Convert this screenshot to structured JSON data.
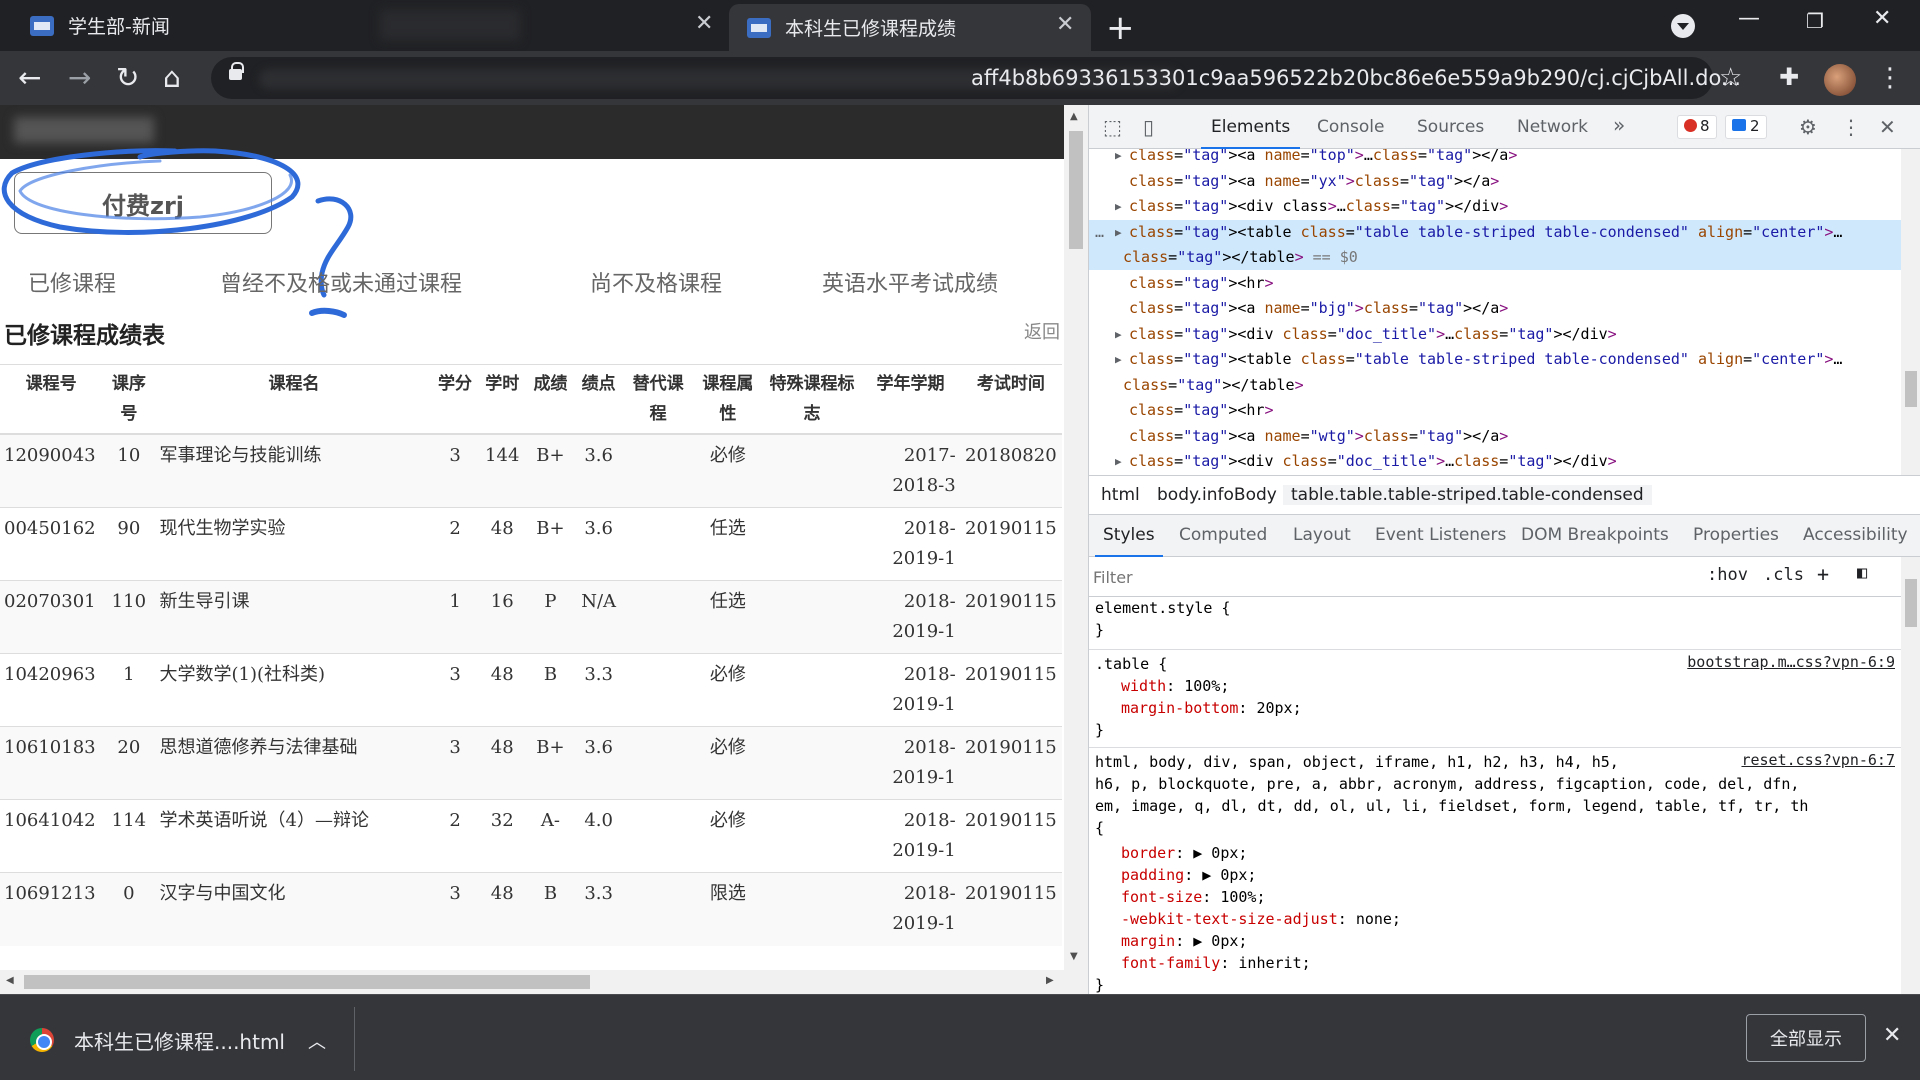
{
  "browser": {
    "tabs": [
      {
        "title": "学生部-新闻",
        "active": false
      },
      {
        "title": "本科生已修课程成绩",
        "active": true
      }
    ],
    "url_visible": "aff4b8b69336153301c9aa596522b20bc86e6e559a9b290/cj.cjCjbAll.do..."
  },
  "page": {
    "pay_button": "付费zrj",
    "scribble_mark": "?",
    "nav_tabs": [
      "已修课程",
      "曾经不及格或未通过课程",
      "尚不及格课程",
      "英语水平考试成绩"
    ],
    "section_title": "已修课程成绩表",
    "back_link": "返回",
    "table": {
      "headers": [
        "课程号",
        "课序号",
        "课程名",
        "学分",
        "学时",
        "成绩",
        "绩点",
        "替代课程",
        "课程属性",
        "特殊课程标志",
        "学年学期",
        "考试时间"
      ],
      "rows": [
        {
          "id": "12090043",
          "seq": "10",
          "name": "军事理论与技能训练",
          "credit": "3",
          "hours": "144",
          "grade": "B+",
          "gpa": "3.6",
          "alt": "",
          "type": "必修",
          "special": "",
          "term": "2017-2018-3",
          "date": "20180820"
        },
        {
          "id": "00450162",
          "seq": "90",
          "name": "现代生物学实验",
          "credit": "2",
          "hours": "48",
          "grade": "B+",
          "gpa": "3.6",
          "alt": "",
          "type": "任选",
          "special": "",
          "term": "2018-2019-1",
          "date": "20190115"
        },
        {
          "id": "02070301",
          "seq": "110",
          "name": "新生导引课",
          "credit": "1",
          "hours": "16",
          "grade": "P",
          "gpa": "N/A",
          "alt": "",
          "type": "任选",
          "special": "",
          "term": "2018-2019-1",
          "date": "20190115"
        },
        {
          "id": "10420963",
          "seq": "1",
          "name": "大学数学(1)(社科类)",
          "credit": "3",
          "hours": "48",
          "grade": "B",
          "gpa": "3.3",
          "alt": "",
          "type": "必修",
          "special": "",
          "term": "2018-2019-1",
          "date": "20190115"
        },
        {
          "id": "10610183",
          "seq": "20",
          "name": "思想道德修养与法律基础",
          "credit": "3",
          "hours": "48",
          "grade": "B+",
          "gpa": "3.6",
          "alt": "",
          "type": "必修",
          "special": "",
          "term": "2018-2019-1",
          "date": "20190115"
        },
        {
          "id": "10641042",
          "seq": "114",
          "name": "学术英语听说（4）—辩论",
          "credit": "2",
          "hours": "32",
          "grade": "A-",
          "gpa": "4.0",
          "alt": "",
          "type": "必修",
          "special": "",
          "term": "2018-2019-1",
          "date": "20190115"
        },
        {
          "id": "10691213",
          "seq": "0",
          "name": "汉字与中国文化",
          "credit": "3",
          "hours": "48",
          "grade": "B",
          "gpa": "3.3",
          "alt": "",
          "type": "限选",
          "special": "",
          "term": "2018-2019-1",
          "date": "20190115"
        }
      ]
    }
  },
  "devtools": {
    "tabs": [
      "Elements",
      "Console",
      "Sources",
      "Network"
    ],
    "more": "»",
    "error_count": "8",
    "message_count": "2",
    "dom_lines": [
      {
        "indent": 1,
        "tri": "▶",
        "html": "<a name=\"top\">…</a>"
      },
      {
        "indent": 1,
        "tri": "",
        "html": "<a name=\"yx\"></a>"
      },
      {
        "indent": 1,
        "tri": "▶",
        "html": "<div class>…</div>"
      },
      {
        "indent": 1,
        "tri": "▶",
        "html": "<table class=\"table table-striped  table-condensed\" align=\"center\">…",
        "selected": true
      },
      {
        "indent": 0,
        "tri": "",
        "html": "</table> == $0",
        "selected": true
      },
      {
        "indent": 1,
        "tri": "",
        "html": "<hr>"
      },
      {
        "indent": 1,
        "tri": "",
        "html": "<a name=\"bjg\"></a>"
      },
      {
        "indent": 1,
        "tri": "▶",
        "html": "<div class=\"doc_title\">…</div>"
      },
      {
        "indent": 1,
        "tri": "▶",
        "html": "<table class=\"table table-striped  table-condensed\" align=\"center\">…"
      },
      {
        "indent": 0,
        "tri": "",
        "html": "</table>"
      },
      {
        "indent": 1,
        "tri": "",
        "html": "<hr>"
      },
      {
        "indent": 1,
        "tri": "",
        "html": "<a name=\"wtg\"></a>"
      },
      {
        "indent": 1,
        "tri": "▶",
        "html": "<div class=\"doc_title\">…</div>"
      }
    ],
    "breadcrumbs": [
      "html",
      "body.infoBody",
      "table.table.table-striped.table-condensed"
    ],
    "styles_tabs": [
      "Styles",
      "Computed",
      "Layout",
      "Event Listeners",
      "DOM Breakpoints",
      "Properties",
      "Accessibility"
    ],
    "filter_placeholder": "Filter",
    "hov": ":hov",
    "cls": ".cls",
    "rules": {
      "element_style": "element.style {",
      "close": "}",
      "table_selector": ".table {",
      "table_src": "bootstrap.m…css?vpn-6:9",
      "table_props": [
        [
          "width",
          "100%;"
        ],
        [
          "margin-bottom",
          "20px;"
        ]
      ],
      "reset_selector_1": "html, body, div, span, object, iframe, h1, h2, h3, h4, h5,",
      "reset_selector_2": "h6, p, blockquote, pre, a, abbr, acronym, address, figcaption, code, del, dfn,",
      "reset_selector_3": "em, image, q, dl, dt, dd, ol, ul, li, fieldset, form, legend, table, tf, tr, th",
      "reset_open": "{",
      "reset_src": "reset.css?vpn-6:7",
      "reset_props": [
        [
          "border",
          "▶ 0px;"
        ],
        [
          "padding",
          "▶ 0px;"
        ],
        [
          "font-size",
          "100%;"
        ],
        [
          "-webkit-text-size-adjust",
          "none;"
        ],
        [
          "margin",
          "▶ 0px;"
        ],
        [
          "font-family",
          "inherit;"
        ]
      ]
    }
  },
  "download": {
    "filename": "本科生已修课程....html",
    "show_all": "全部显示"
  },
  "colors": {
    "devtools_accent": "#1a73e8",
    "tab_bg": "#202124",
    "toolbar_bg": "#35363a",
    "scribble": "#2f6ad9"
  }
}
